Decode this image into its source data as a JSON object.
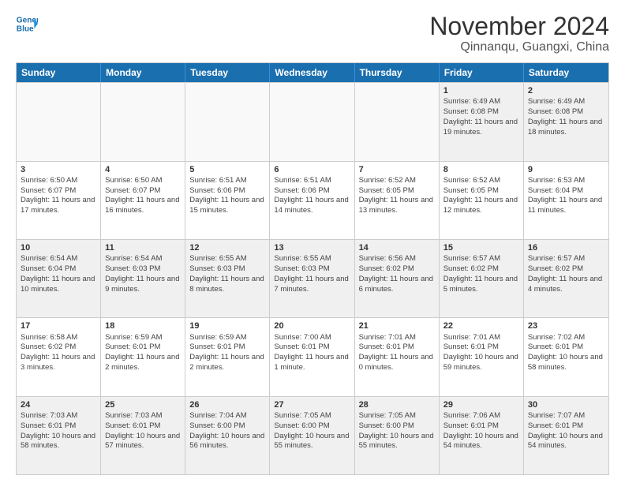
{
  "logo": {
    "line1": "General",
    "line2": "Blue",
    "arrow_color": "#1a6faf"
  },
  "title": "November 2024",
  "location": "Qinnanqu, Guangxi, China",
  "header_days": [
    "Sunday",
    "Monday",
    "Tuesday",
    "Wednesday",
    "Thursday",
    "Friday",
    "Saturday"
  ],
  "weeks": [
    [
      {
        "day": "",
        "info": ""
      },
      {
        "day": "",
        "info": ""
      },
      {
        "day": "",
        "info": ""
      },
      {
        "day": "",
        "info": ""
      },
      {
        "day": "",
        "info": ""
      },
      {
        "day": "1",
        "info": "Sunrise: 6:49 AM\nSunset: 6:08 PM\nDaylight: 11 hours and 19 minutes."
      },
      {
        "day": "2",
        "info": "Sunrise: 6:49 AM\nSunset: 6:08 PM\nDaylight: 11 hours and 18 minutes."
      }
    ],
    [
      {
        "day": "3",
        "info": "Sunrise: 6:50 AM\nSunset: 6:07 PM\nDaylight: 11 hours and 17 minutes."
      },
      {
        "day": "4",
        "info": "Sunrise: 6:50 AM\nSunset: 6:07 PM\nDaylight: 11 hours and 16 minutes."
      },
      {
        "day": "5",
        "info": "Sunrise: 6:51 AM\nSunset: 6:06 PM\nDaylight: 11 hours and 15 minutes."
      },
      {
        "day": "6",
        "info": "Sunrise: 6:51 AM\nSunset: 6:06 PM\nDaylight: 11 hours and 14 minutes."
      },
      {
        "day": "7",
        "info": "Sunrise: 6:52 AM\nSunset: 6:05 PM\nDaylight: 11 hours and 13 minutes."
      },
      {
        "day": "8",
        "info": "Sunrise: 6:52 AM\nSunset: 6:05 PM\nDaylight: 11 hours and 12 minutes."
      },
      {
        "day": "9",
        "info": "Sunrise: 6:53 AM\nSunset: 6:04 PM\nDaylight: 11 hours and 11 minutes."
      }
    ],
    [
      {
        "day": "10",
        "info": "Sunrise: 6:54 AM\nSunset: 6:04 PM\nDaylight: 11 hours and 10 minutes."
      },
      {
        "day": "11",
        "info": "Sunrise: 6:54 AM\nSunset: 6:03 PM\nDaylight: 11 hours and 9 minutes."
      },
      {
        "day": "12",
        "info": "Sunrise: 6:55 AM\nSunset: 6:03 PM\nDaylight: 11 hours and 8 minutes."
      },
      {
        "day": "13",
        "info": "Sunrise: 6:55 AM\nSunset: 6:03 PM\nDaylight: 11 hours and 7 minutes."
      },
      {
        "day": "14",
        "info": "Sunrise: 6:56 AM\nSunset: 6:02 PM\nDaylight: 11 hours and 6 minutes."
      },
      {
        "day": "15",
        "info": "Sunrise: 6:57 AM\nSunset: 6:02 PM\nDaylight: 11 hours and 5 minutes."
      },
      {
        "day": "16",
        "info": "Sunrise: 6:57 AM\nSunset: 6:02 PM\nDaylight: 11 hours and 4 minutes."
      }
    ],
    [
      {
        "day": "17",
        "info": "Sunrise: 6:58 AM\nSunset: 6:02 PM\nDaylight: 11 hours and 3 minutes."
      },
      {
        "day": "18",
        "info": "Sunrise: 6:59 AM\nSunset: 6:01 PM\nDaylight: 11 hours and 2 minutes."
      },
      {
        "day": "19",
        "info": "Sunrise: 6:59 AM\nSunset: 6:01 PM\nDaylight: 11 hours and 2 minutes."
      },
      {
        "day": "20",
        "info": "Sunrise: 7:00 AM\nSunset: 6:01 PM\nDaylight: 11 hours and 1 minute."
      },
      {
        "day": "21",
        "info": "Sunrise: 7:01 AM\nSunset: 6:01 PM\nDaylight: 11 hours and 0 minutes."
      },
      {
        "day": "22",
        "info": "Sunrise: 7:01 AM\nSunset: 6:01 PM\nDaylight: 10 hours and 59 minutes."
      },
      {
        "day": "23",
        "info": "Sunrise: 7:02 AM\nSunset: 6:01 PM\nDaylight: 10 hours and 58 minutes."
      }
    ],
    [
      {
        "day": "24",
        "info": "Sunrise: 7:03 AM\nSunset: 6:01 PM\nDaylight: 10 hours and 58 minutes."
      },
      {
        "day": "25",
        "info": "Sunrise: 7:03 AM\nSunset: 6:01 PM\nDaylight: 10 hours and 57 minutes."
      },
      {
        "day": "26",
        "info": "Sunrise: 7:04 AM\nSunset: 6:00 PM\nDaylight: 10 hours and 56 minutes."
      },
      {
        "day": "27",
        "info": "Sunrise: 7:05 AM\nSunset: 6:00 PM\nDaylight: 10 hours and 55 minutes."
      },
      {
        "day": "28",
        "info": "Sunrise: 7:05 AM\nSunset: 6:00 PM\nDaylight: 10 hours and 55 minutes."
      },
      {
        "day": "29",
        "info": "Sunrise: 7:06 AM\nSunset: 6:01 PM\nDaylight: 10 hours and 54 minutes."
      },
      {
        "day": "30",
        "info": "Sunrise: 7:07 AM\nSunset: 6:01 PM\nDaylight: 10 hours and 54 minutes."
      }
    ]
  ]
}
